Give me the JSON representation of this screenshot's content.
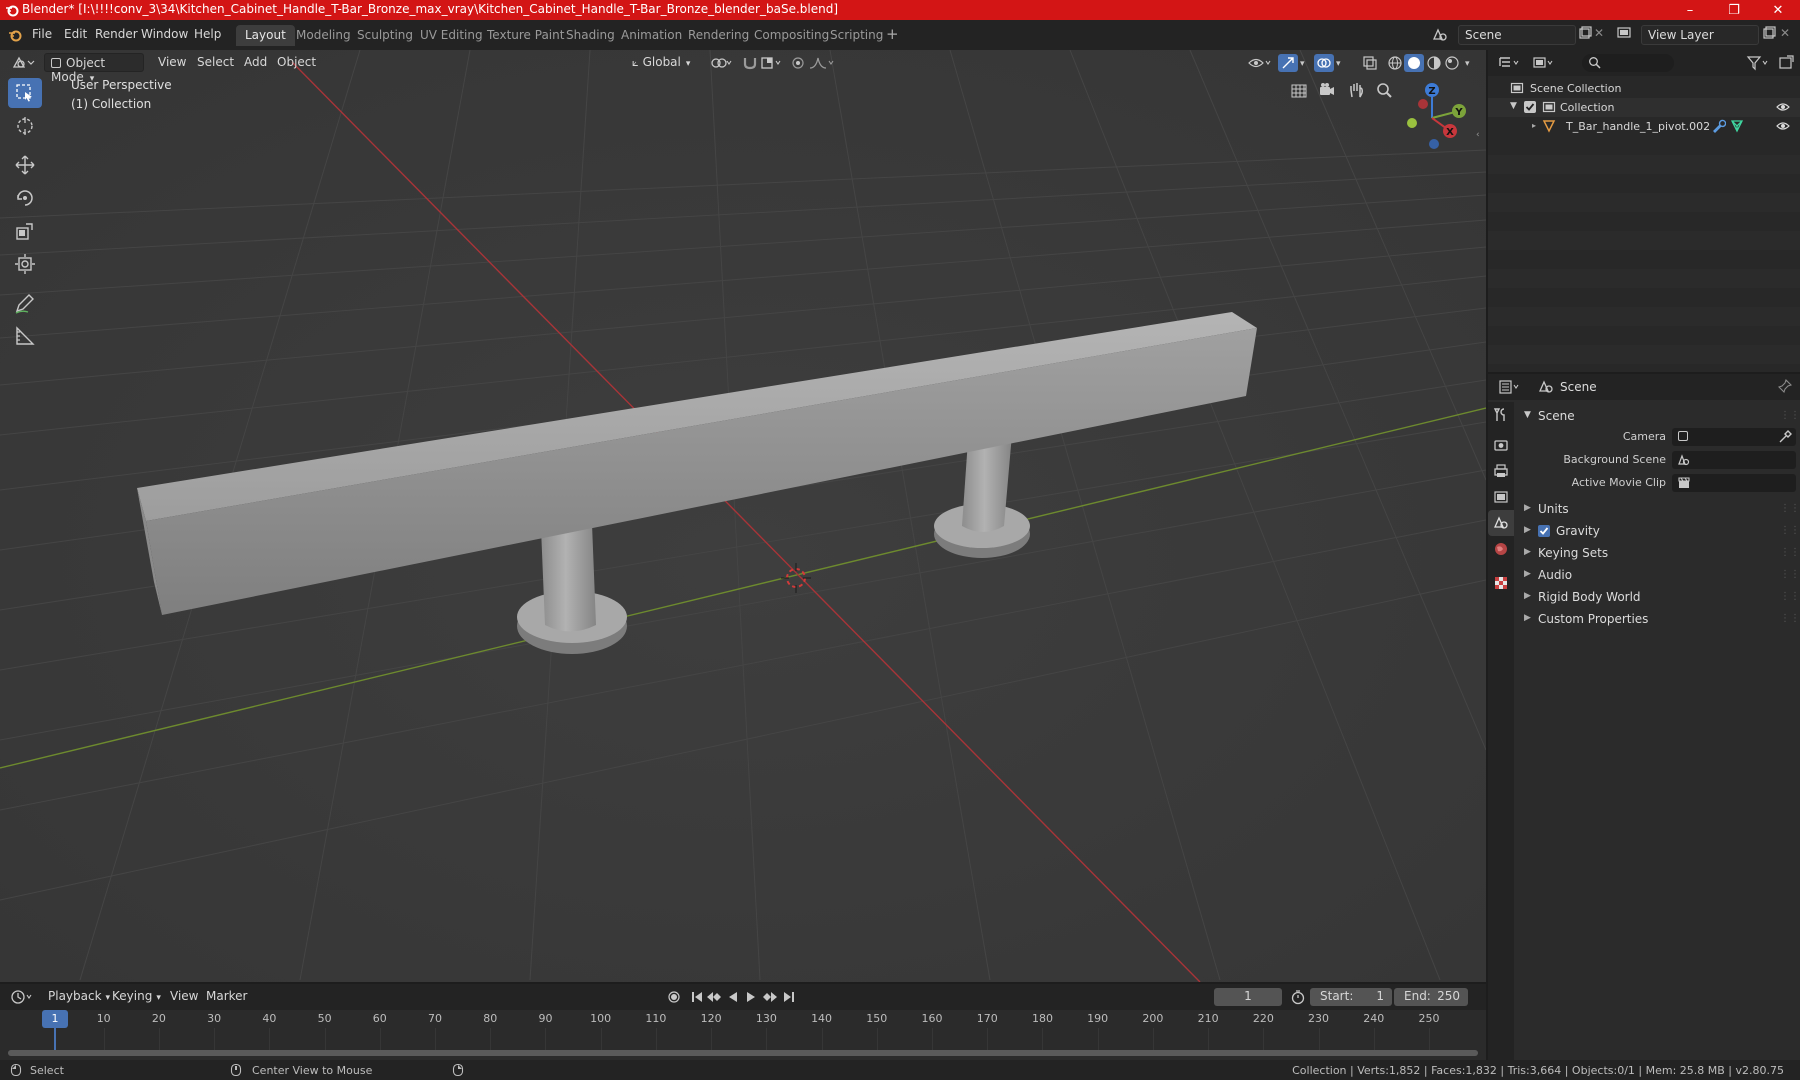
{
  "window": {
    "title": "Blender* [I:\\!!!!conv_3\\34\\Kitchen_Cabinet_Handle_T-Bar_Bronze_max_vray\\Kitchen_Cabinet_Handle_T-Bar_Bronze_blender_baSe.blend]",
    "minimize": "–",
    "maximize": "❐",
    "close": "✕"
  },
  "menu": [
    "File",
    "Edit",
    "Render",
    "Window",
    "Help"
  ],
  "workspaces": [
    "Layout",
    "Modeling",
    "Sculpting",
    "UV Editing",
    "Texture Paint",
    "Shading",
    "Animation",
    "Rendering",
    "Compositing",
    "Scripting"
  ],
  "workspace_add": "+",
  "scene_selector": "Scene",
  "view_layer_selector": "View Layer",
  "viewport_header": {
    "mode": "Object Mode",
    "menus": [
      "View",
      "Select",
      "Add",
      "Object"
    ],
    "transform_orientation": "Global"
  },
  "viewport_overlay": {
    "line1": "User Perspective",
    "line2": "(1) Collection"
  },
  "gizmo": {
    "z": "Z",
    "y": "Y",
    "x": "X"
  },
  "outliner": {
    "root": "Scene Collection",
    "collection": "Collection",
    "object": "T_Bar_handle_1_pivot.002"
  },
  "properties": {
    "header": "Scene",
    "panel_title": "Scene",
    "camera_label": "Camera",
    "background_scene_label": "Background Scene",
    "active_movie_clip_label": "Active Movie Clip",
    "panels": [
      "Units",
      "Gravity",
      "Keying Sets",
      "Audio",
      "Rigid Body World",
      "Custom Properties"
    ],
    "gravity_checked": true
  },
  "timeline": {
    "menus": [
      "Playback",
      "Keying",
      "View",
      "Marker"
    ],
    "current_frame": "1",
    "start_label": "Start:",
    "start_value": "1",
    "end_label": "End:",
    "end_value": "250",
    "ruler": [
      "1",
      "10",
      "20",
      "30",
      "40",
      "50",
      "60",
      "70",
      "80",
      "90",
      "100",
      "110",
      "120",
      "130",
      "140",
      "150",
      "160",
      "170",
      "180",
      "190",
      "200",
      "210",
      "220",
      "230",
      "240",
      "250"
    ]
  },
  "statusbar": {
    "left": "Select",
    "middle": "Center View to Mouse",
    "right": "Collection | Verts:1,852 | Faces:1,832 | Tris:3,664 | Objects:0/1 | Mem: 25.8 MB | v2.80.75"
  },
  "colors": {
    "titlebar": "#d31515",
    "accent": "#4772b3",
    "viewport_bg": "#393939",
    "axis_x": "#c8373c",
    "axis_y": "#7ca33a",
    "axis_z": "#3d7bd6"
  }
}
